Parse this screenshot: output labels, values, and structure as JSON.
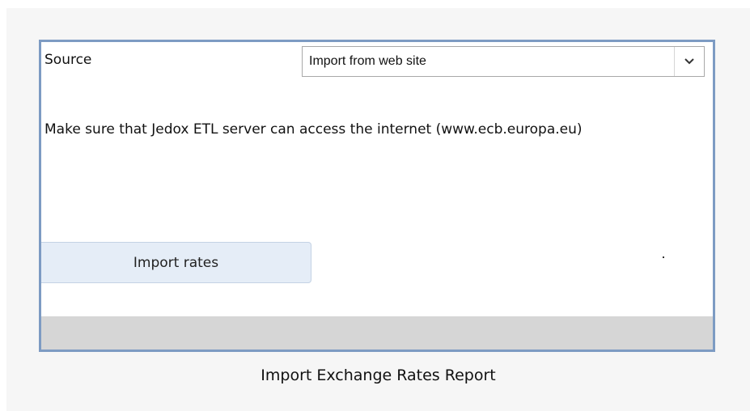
{
  "form": {
    "source_label": "Source",
    "source_select": {
      "selected": "Import from web site"
    },
    "info_text": "Make sure that Jedox ETL server can access the internet (www.ecb.europa.eu)",
    "import_button_label": "Import rates",
    "dot": "."
  },
  "caption": "Import Exchange Rates Report",
  "colors": {
    "frame_border": "#7d9bc3",
    "button_bg": "#e5edf7",
    "status_bar": "#d6d6d6",
    "page_bg": "#f6f6f6"
  },
  "icons": {
    "dropdown": "chevron-down-icon"
  }
}
